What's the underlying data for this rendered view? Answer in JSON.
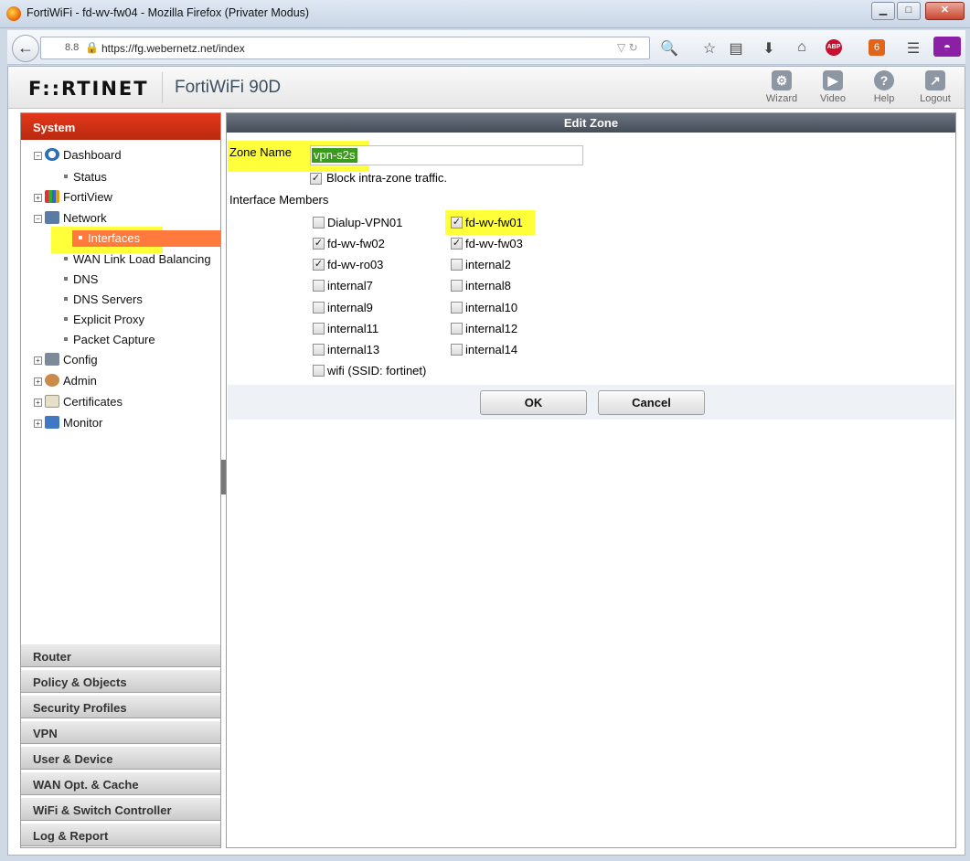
{
  "window": {
    "title": "FortiWiFi - fd-wv-fw04 - Mozilla Firefox (Privater Modus)",
    "min_label": "▁",
    "max_label": "□",
    "close_label": "✕"
  },
  "browser": {
    "zoom": "8.8",
    "url": "https://fg.webernetz.net/index",
    "badge_count": "6"
  },
  "header": {
    "logo": "F::RTINET",
    "model": "FortiWiFi 90D",
    "tools": [
      {
        "label": "Wizard",
        "icon": "wizard-icon"
      },
      {
        "label": "Video",
        "icon": "video-icon"
      },
      {
        "label": "Help",
        "icon": "help-icon"
      },
      {
        "label": "Logout",
        "icon": "logout-icon"
      }
    ]
  },
  "sidebar": {
    "section": "System",
    "tree": {
      "dashboard": "Dashboard",
      "status": "Status",
      "fortiview": "FortiView",
      "network": "Network",
      "interfaces": "Interfaces",
      "wan_lb": "WAN Link Load Balancing",
      "dns": "DNS",
      "dns_servers": "DNS Servers",
      "explicit_proxy": "Explicit Proxy",
      "packet_capture": "Packet Capture",
      "config": "Config",
      "admin": "Admin",
      "certificates": "Certificates",
      "monitor": "Monitor"
    },
    "sections": [
      "Router",
      "Policy & Objects",
      "Security Profiles",
      "VPN",
      "User & Device",
      "WAN Opt. & Cache",
      "WiFi & Switch Controller",
      "Log & Report"
    ]
  },
  "edit_zone": {
    "title": "Edit Zone",
    "zone_name_label": "Zone Name",
    "zone_name_value": "vpn-s2s",
    "block_label": "Block intra-zone traffic.",
    "block_checked": true,
    "members_label": "Interface Members",
    "members": [
      {
        "label": "Dialup-VPN01",
        "checked": false
      },
      {
        "label": "fd-wv-fw01",
        "checked": true
      },
      {
        "label": "fd-wv-fw02",
        "checked": true
      },
      {
        "label": "fd-wv-fw03",
        "checked": true
      },
      {
        "label": "fd-wv-ro03",
        "checked": true
      },
      {
        "label": "internal2",
        "checked": false
      },
      {
        "label": "internal7",
        "checked": false
      },
      {
        "label": "internal8",
        "checked": false
      },
      {
        "label": "internal9",
        "checked": false
      },
      {
        "label": "internal10",
        "checked": false
      },
      {
        "label": "internal11",
        "checked": false
      },
      {
        "label": "internal12",
        "checked": false
      },
      {
        "label": "internal13",
        "checked": false
      },
      {
        "label": "internal14",
        "checked": false
      },
      {
        "label": "wifi (SSID: fortinet)",
        "checked": false
      }
    ],
    "ok_label": "OK",
    "cancel_label": "Cancel"
  }
}
